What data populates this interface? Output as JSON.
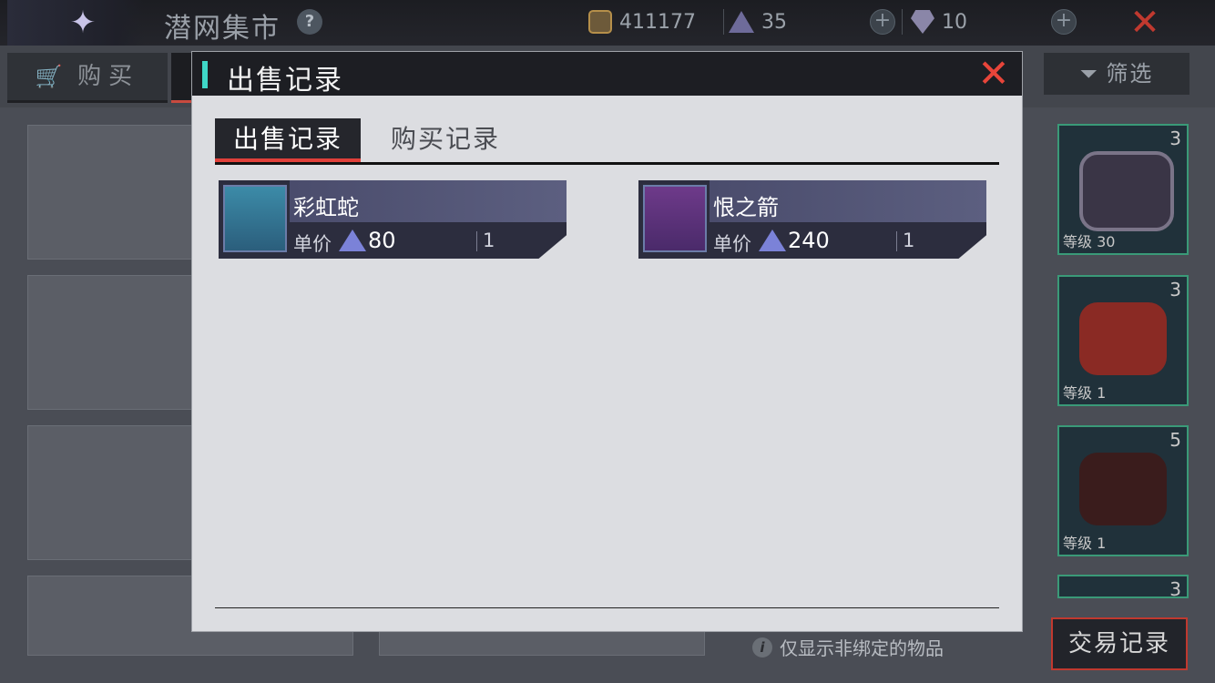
{
  "topbar": {
    "title": "潜网集市",
    "help": "?",
    "gold": "411177",
    "crystal": "35",
    "diamond": "10",
    "plus": "+",
    "close": "✕"
  },
  "tabs": {
    "buy": "购买",
    "filter": "筛选"
  },
  "background": {
    "slots": [
      {
        "num": "3",
        "level": "等级 30"
      },
      {
        "num": "3",
        "level": "等级 1"
      },
      {
        "num": "5",
        "level": "等级 1"
      },
      {
        "num": "3",
        "level": ""
      }
    ],
    "bind_note": "仅显示非绑定的物品",
    "trade_button": "交易记录"
  },
  "modal": {
    "title": "出售记录",
    "close": "✕",
    "tabs": {
      "sell": "出售记录",
      "buy": "购买记录"
    },
    "records": [
      {
        "name": "彩虹蛇",
        "price_label": "单价",
        "price": "80",
        "qty": "1",
        "icon": "snake-icon"
      },
      {
        "name": "恨之箭",
        "price_label": "单价",
        "price": "240",
        "qty": "1",
        "icon": "bow-icon"
      }
    ]
  }
}
